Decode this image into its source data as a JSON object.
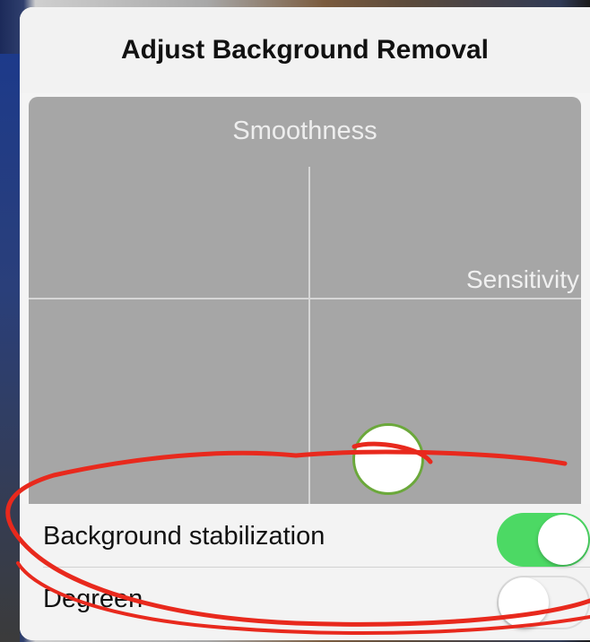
{
  "dialog": {
    "title": "Adjust Background Removal"
  },
  "pad": {
    "top_axis_label": "Smoothness",
    "right_axis_label": "Sensitivity"
  },
  "settings": {
    "items": [
      {
        "label": "Background stabilization",
        "enabled": true
      },
      {
        "label": "Degreen",
        "enabled": false
      }
    ]
  },
  "colors": {
    "toggle_on": "#4cd964",
    "handle_border": "#6ba83b",
    "annotation": "#e8291d"
  }
}
